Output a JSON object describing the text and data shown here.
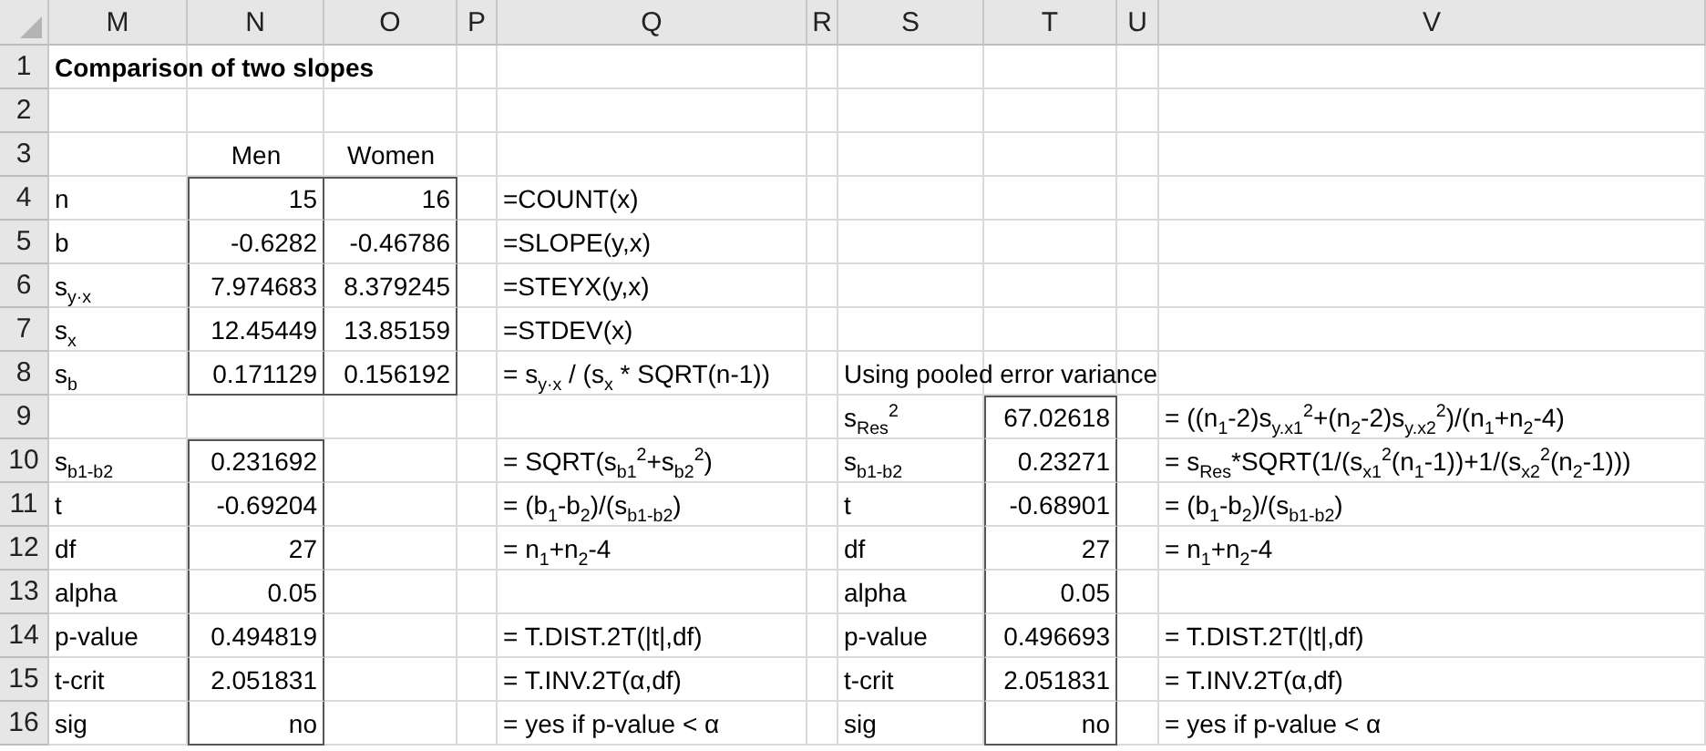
{
  "columns": [
    "M",
    "N",
    "O",
    "P",
    "Q",
    "R",
    "S",
    "T",
    "U",
    "V"
  ],
  "row_numbers": [
    "1",
    "2",
    "3",
    "4",
    "5",
    "6",
    "7",
    "8",
    "9",
    "10",
    "11",
    "12",
    "13",
    "14",
    "15",
    "16"
  ],
  "rows": [
    {
      "M": {
        "kind": "title",
        "text": "Comparison of two slopes"
      }
    },
    {},
    {
      "N": {
        "kind": "heading",
        "text": "Men"
      },
      "O": {
        "kind": "heading",
        "text": "Women"
      }
    },
    {
      "M": {
        "kind": "label",
        "text": "n"
      },
      "N": {
        "kind": "number",
        "text": "15",
        "boxed": true
      },
      "O": {
        "kind": "number",
        "text": "16",
        "boxed": true
      },
      "Q": {
        "kind": "formula",
        "text": "=COUNT(x)"
      }
    },
    {
      "M": {
        "kind": "label",
        "text": "b"
      },
      "N": {
        "kind": "number",
        "text": "-0.6282",
        "boxed": true
      },
      "O": {
        "kind": "number",
        "text": "-0.46786",
        "boxed": true
      },
      "Q": {
        "kind": "formula",
        "text": "=SLOPE(y,x)"
      }
    },
    {
      "M": {
        "kind": "label",
        "text": "s$_{y·x}$"
      },
      "N": {
        "kind": "number",
        "text": "7.974683",
        "boxed": true
      },
      "O": {
        "kind": "number",
        "text": "8.379245",
        "boxed": true
      },
      "Q": {
        "kind": "formula",
        "text": "=STEYX(y,x)"
      }
    },
    {
      "M": {
        "kind": "label",
        "text": "s$_{x}$"
      },
      "N": {
        "kind": "number",
        "text": "12.45449",
        "boxed": true
      },
      "O": {
        "kind": "number",
        "text": "13.85159",
        "boxed": true
      },
      "Q": {
        "kind": "formula",
        "text": "=STDEV(x)"
      }
    },
    {
      "M": {
        "kind": "label",
        "text": "s$_{b}$"
      },
      "N": {
        "kind": "number",
        "text": "0.171129",
        "boxed": true
      },
      "O": {
        "kind": "number",
        "text": "0.156192",
        "boxed": true
      },
      "Q": {
        "kind": "formula",
        "text": "= s$_{y·x}$ / (s$_{x}$ * SQRT(n-1))"
      },
      "S": {
        "kind": "label",
        "text": "Using pooled error variance"
      }
    },
    {
      "S": {
        "kind": "label",
        "text": "s$_{Res}$$^{2}$"
      },
      "T": {
        "kind": "number",
        "text": "67.02618",
        "boxed": true
      },
      "V": {
        "kind": "formula",
        "text": "= ((n$_{1}$-2)s$_{y.x1}$$^{2}$+(n$_{2}$-2)s$_{y.x2}$$^{2}$)/(n$_{1}$+n$_{2}$-4)"
      }
    },
    {
      "M": {
        "kind": "label",
        "text": "s$_{b1-b2}$"
      },
      "N": {
        "kind": "number",
        "text": "0.231692",
        "boxed": true
      },
      "Q": {
        "kind": "formula",
        "text": "= SQRT(s$_{b1}$$^{2}$+s$_{b2}$$^{2}$)"
      },
      "S": {
        "kind": "label",
        "text": "s$_{b1-b2}$"
      },
      "T": {
        "kind": "number",
        "text": "0.23271",
        "boxed": true
      },
      "V": {
        "kind": "formula",
        "text": "= s$_{Res}$*SQRT(1/(s$_{x1}$$^{2}$(n$_{1}$-1))+1/(s$_{x2}$$^{2}$(n$_{2}$-1)))"
      }
    },
    {
      "M": {
        "kind": "label",
        "text": "t"
      },
      "N": {
        "kind": "number",
        "text": "-0.69204",
        "boxed": true
      },
      "Q": {
        "kind": "formula",
        "text": "= (b$_{1}$-b$_{2}$)/(s$_{b1-b2}$)"
      },
      "S": {
        "kind": "label",
        "text": "t"
      },
      "T": {
        "kind": "number",
        "text": "-0.68901",
        "boxed": true
      },
      "V": {
        "kind": "formula",
        "text": "= (b$_{1}$-b$_{2}$)/(s$_{b1-b2}$)"
      }
    },
    {
      "M": {
        "kind": "label",
        "text": "df"
      },
      "N": {
        "kind": "number",
        "text": "27",
        "boxed": true
      },
      "Q": {
        "kind": "formula",
        "text": "= n$_{1}$+n$_{2}$-4"
      },
      "S": {
        "kind": "label",
        "text": "df"
      },
      "T": {
        "kind": "number",
        "text": "27",
        "boxed": true
      },
      "V": {
        "kind": "formula",
        "text": "= n$_{1}$+n$_{2}$-4"
      }
    },
    {
      "M": {
        "kind": "label",
        "text": "alpha"
      },
      "N": {
        "kind": "number",
        "text": "0.05",
        "boxed": true
      },
      "S": {
        "kind": "label",
        "text": "alpha"
      },
      "T": {
        "kind": "number",
        "text": "0.05",
        "boxed": true
      }
    },
    {
      "M": {
        "kind": "label",
        "text": "p-value"
      },
      "N": {
        "kind": "number",
        "text": "0.494819",
        "boxed": true
      },
      "Q": {
        "kind": "formula",
        "text": "= T.DIST.2T(|t|,df)"
      },
      "S": {
        "kind": "label",
        "text": "p-value"
      },
      "T": {
        "kind": "number",
        "text": "0.496693",
        "boxed": true
      },
      "V": {
        "kind": "formula",
        "text": "= T.DIST.2T(|t|,df)"
      }
    },
    {
      "M": {
        "kind": "label",
        "text": "t-crit"
      },
      "N": {
        "kind": "number",
        "text": "2.051831",
        "boxed": true
      },
      "Q": {
        "kind": "formula",
        "text": "= T.INV.2T(α,df)"
      },
      "S": {
        "kind": "label",
        "text": "t-crit"
      },
      "T": {
        "kind": "number",
        "text": "2.051831",
        "boxed": true
      },
      "V": {
        "kind": "formula",
        "text": "= T.INV.2T(α,df)"
      }
    },
    {
      "M": {
        "kind": "label",
        "text": "sig"
      },
      "N": {
        "kind": "number",
        "text": "no",
        "boxed": true
      },
      "Q": {
        "kind": "formula",
        "text": "= yes if p-value < α"
      },
      "S": {
        "kind": "label",
        "text": "sig"
      },
      "T": {
        "kind": "number",
        "text": "no",
        "boxed": true
      },
      "V": {
        "kind": "formula",
        "text": "= yes if p-value < α"
      }
    }
  ]
}
